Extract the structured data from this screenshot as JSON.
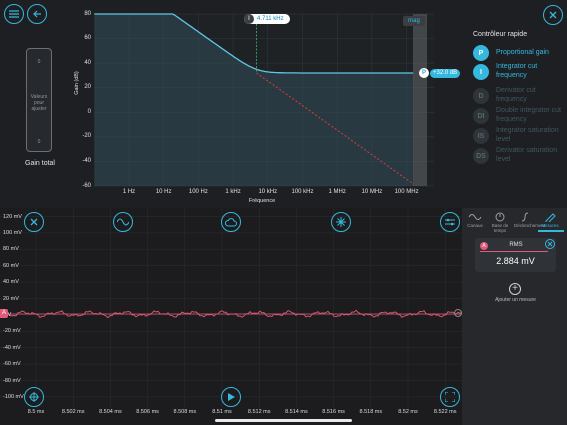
{
  "bode": {
    "y_ticks": [
      "80",
      "60",
      "40",
      "20",
      "0",
      "-20",
      "-40",
      "-60"
    ],
    "x_ticks": [
      "1 Hz",
      "10 Hz",
      "100 Hz",
      "1 kHz",
      "10 kHz",
      "100 kHz",
      "1 MHz",
      "10 MHz",
      "100 MHz"
    ],
    "ylabel": "Gain (dB)",
    "xlabel": "Fréquence",
    "cursor": {
      "badge": "I",
      "value": "4.711 kHz"
    },
    "p_marker": {
      "badge": "P",
      "value": "+32.0 dB"
    },
    "mag_label": "mag",
    "colors": {
      "curve": "#5ec8e6",
      "asymptote": "#e03a3a",
      "cursor": "#3cb878"
    }
  },
  "left_panel": {
    "slider_top": "0",
    "slider_text": "Valeurs pour ajuster",
    "slider_bottom": "0",
    "gain_label": "Gain total"
  },
  "controller": {
    "title": "Contrôleur rapide",
    "items": [
      {
        "badge": "P",
        "label": "Proportional gain",
        "active": true
      },
      {
        "badge": "I",
        "label": "Integrator cut frequency",
        "active": true
      },
      {
        "badge": "D",
        "label": "Derivator cut frequency",
        "active": false
      },
      {
        "badge": "DI",
        "label": "Double integrator cut frequency",
        "active": false
      },
      {
        "badge": "IS",
        "label": "Integrator saturation level",
        "active": false
      },
      {
        "badge": "DS",
        "label": "Derivator saturation level",
        "active": false
      }
    ]
  },
  "scope": {
    "y_ticks": [
      "120 mV",
      "100 mV",
      "80 mV",
      "60 mV",
      "40 mV",
      "20 mV",
      "0 V",
      "-20 mV",
      "-40 mV",
      "-60 mV",
      "-80 mV",
      "-100 mV"
    ],
    "x_ticks": [
      "8.5 ms",
      "8.502 ms",
      "8.504 ms",
      "8.506 ms",
      "8.508 ms",
      "8.51 ms",
      "8.512 ms",
      "8.514 ms",
      "8.516 ms",
      "8.518 ms",
      "8.52 ms",
      "8.522 ms"
    ],
    "channel_badge": "A",
    "signal_color": "#e05a7a"
  },
  "tabs": [
    "Canaux",
    "Base de temps",
    "Déclenchement",
    "Mesures"
  ],
  "measure": {
    "badge": "A",
    "name": "RMS",
    "value": "2.884 mV",
    "add_label": "Ajouter un mesure"
  }
}
